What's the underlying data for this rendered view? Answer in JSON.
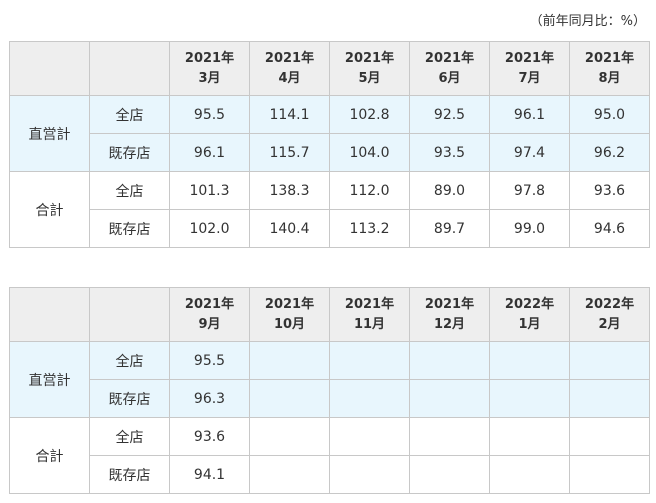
{
  "unit_note": "（前年同月比：%）",
  "tables": [
    {
      "months": [
        {
          "year": "2021年",
          "month": "3月"
        },
        {
          "year": "2021年",
          "month": "4月"
        },
        {
          "year": "2021年",
          "month": "5月"
        },
        {
          "year": "2021年",
          "month": "6月"
        },
        {
          "year": "2021年",
          "month": "7月"
        },
        {
          "year": "2021年",
          "month": "8月"
        }
      ],
      "groups": [
        {
          "label": "直営計",
          "rows": [
            {
              "label": "全店",
              "values": [
                "95.5",
                "114.1",
                "102.8",
                "92.5",
                "96.1",
                "95.0"
              ]
            },
            {
              "label": "既存店",
              "values": [
                "96.1",
                "115.7",
                "104.0",
                "93.5",
                "97.4",
                "96.2"
              ]
            }
          ]
        },
        {
          "label": "合計",
          "rows": [
            {
              "label": "全店",
              "values": [
                "101.3",
                "138.3",
                "112.0",
                "89.0",
                "97.8",
                "93.6"
              ]
            },
            {
              "label": "既存店",
              "values": [
                "102.0",
                "140.4",
                "113.2",
                "89.7",
                "99.0",
                "94.6"
              ]
            }
          ]
        }
      ]
    },
    {
      "months": [
        {
          "year": "2021年",
          "month": "9月"
        },
        {
          "year": "2021年",
          "month": "10月"
        },
        {
          "year": "2021年",
          "month": "11月"
        },
        {
          "year": "2021年",
          "month": "12月"
        },
        {
          "year": "2022年",
          "month": "1月"
        },
        {
          "year": "2022年",
          "month": "2月"
        }
      ],
      "groups": [
        {
          "label": "直営計",
          "rows": [
            {
              "label": "全店",
              "values": [
                "95.5",
                "",
                "",
                "",
                "",
                ""
              ]
            },
            {
              "label": "既存店",
              "values": [
                "96.3",
                "",
                "",
                "",
                "",
                ""
              ]
            }
          ]
        },
        {
          "label": "合計",
          "rows": [
            {
              "label": "全店",
              "values": [
                "93.6",
                "",
                "",
                "",
                "",
                ""
              ]
            },
            {
              "label": "既存店",
              "values": [
                "94.1",
                "",
                "",
                "",
                "",
                ""
              ]
            }
          ]
        }
      ]
    }
  ]
}
